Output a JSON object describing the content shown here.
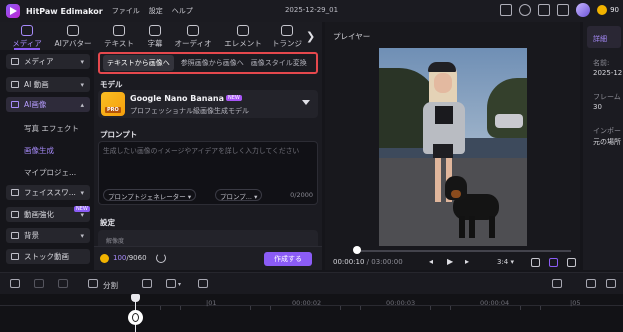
{
  "titlebar": {
    "app_name": "HitPaw Edimakor",
    "menu": [
      "ファイル",
      "設定",
      "ヘルプ"
    ],
    "project_name": "2025-12-29_01",
    "credits_badge": "90"
  },
  "toolbar": {
    "tools": [
      {
        "label": "メディア",
        "icon": "media-icon",
        "active": true
      },
      {
        "label": "AIアバター",
        "icon": "avatar-icon"
      },
      {
        "label": "テキスト",
        "icon": "text-icon"
      },
      {
        "label": "字幕",
        "icon": "subtitle-icon"
      },
      {
        "label": "オーディオ",
        "icon": "audio-icon"
      },
      {
        "label": "エレメント",
        "icon": "element-icon"
      },
      {
        "label": "トランジ",
        "icon": "transition-icon"
      }
    ]
  },
  "sidebar": {
    "items": [
      {
        "label": "メディア"
      },
      {
        "label": "AI 動画"
      },
      {
        "label": "AI画像",
        "expanded": true
      },
      {
        "label": "フェイススワ..."
      },
      {
        "label": "動画強化",
        "badge": "NEW"
      },
      {
        "label": "背景"
      },
      {
        "label": "ストック動画"
      }
    ],
    "subitems": [
      {
        "label": "写真 エフェクト"
      },
      {
        "label": "画像生成",
        "active": true
      },
      {
        "label": "マイプロジェ..."
      }
    ]
  },
  "panel": {
    "tabs": [
      {
        "label": "テキストから画像へ",
        "active": true
      },
      {
        "label": "参照画像から画像へ"
      },
      {
        "label": "画像スタイル変換"
      }
    ],
    "model_label": "モデル",
    "model": {
      "name": "Google Nano Banana Pro",
      "badge": "NEW",
      "icon_tag": "PRO",
      "description": "プロフェッショナル級画像生成モデル"
    },
    "prompt_label": "プロンプト",
    "prompt": {
      "placeholder": "生成したい画像のイメージやアイデアを詳しく入力してください",
      "value": "",
      "generator_chip": "プロンプトジェネレーター",
      "template_chip": "プロンプ...",
      "char_count": "0/2000"
    },
    "settings_label": "設定",
    "settings_sub": "解像度",
    "credits": {
      "used": "100",
      "total": "/9060"
    },
    "generate_label": "作成する"
  },
  "player": {
    "title": "プレイヤー",
    "current_time": "00:00:10",
    "total_time": " / 03:00:00",
    "aspect_ratio": "3:4",
    "progress": 0.0
  },
  "right_panel": {
    "tab": "詳細",
    "rows": [
      {
        "label": "名前:",
        "value": "2025-12..."
      },
      {
        "label": "フレーム",
        "value": "30"
      },
      {
        "label": "インポー",
        "value": "元の場所"
      }
    ]
  },
  "timeline": {
    "split_label": "分割",
    "ticks": [
      "00:00",
      "|01",
      "00:00:02",
      "00:00:03",
      "00:00:04",
      "|05"
    ]
  }
}
